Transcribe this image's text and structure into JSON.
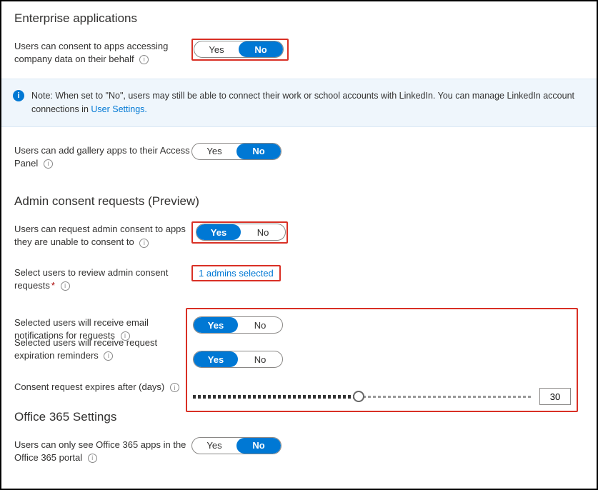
{
  "sections": {
    "enterprise": "Enterprise applications",
    "adminConsent": "Admin consent requests (Preview)",
    "office365": "Office 365 Settings"
  },
  "labels": {
    "consentApps": "Users can consent to apps accessing company data on their behalf",
    "addGallery": "Users can add gallery apps to their Access Panel",
    "requestAdmin": "Users can request admin consent to apps they are unable to consent to",
    "selectReviewers": "Select users to review admin consent requests",
    "emailNotify": "Selected users will receive email notifications for requests",
    "expireRemind": "Selected users will receive request expiration reminders",
    "expireDays": "Consent request expires after (days)",
    "o365Apps": "Users can only see Office 365 apps in the Office 365 portal"
  },
  "toggle": {
    "yes": "Yes",
    "no": "No"
  },
  "callout": {
    "text": "Note: When set to \"No\", users may still be able to connect their work or school accounts with LinkedIn. You can manage LinkedIn account connections in ",
    "link": "User Settings."
  },
  "adminsSelected": "1 admins selected",
  "values": {
    "consentApps": "No",
    "addGallery": "No",
    "requestAdmin": "Yes",
    "emailNotify": "Yes",
    "expireRemind": "Yes",
    "o365Apps": "No",
    "expireDays": "30"
  }
}
